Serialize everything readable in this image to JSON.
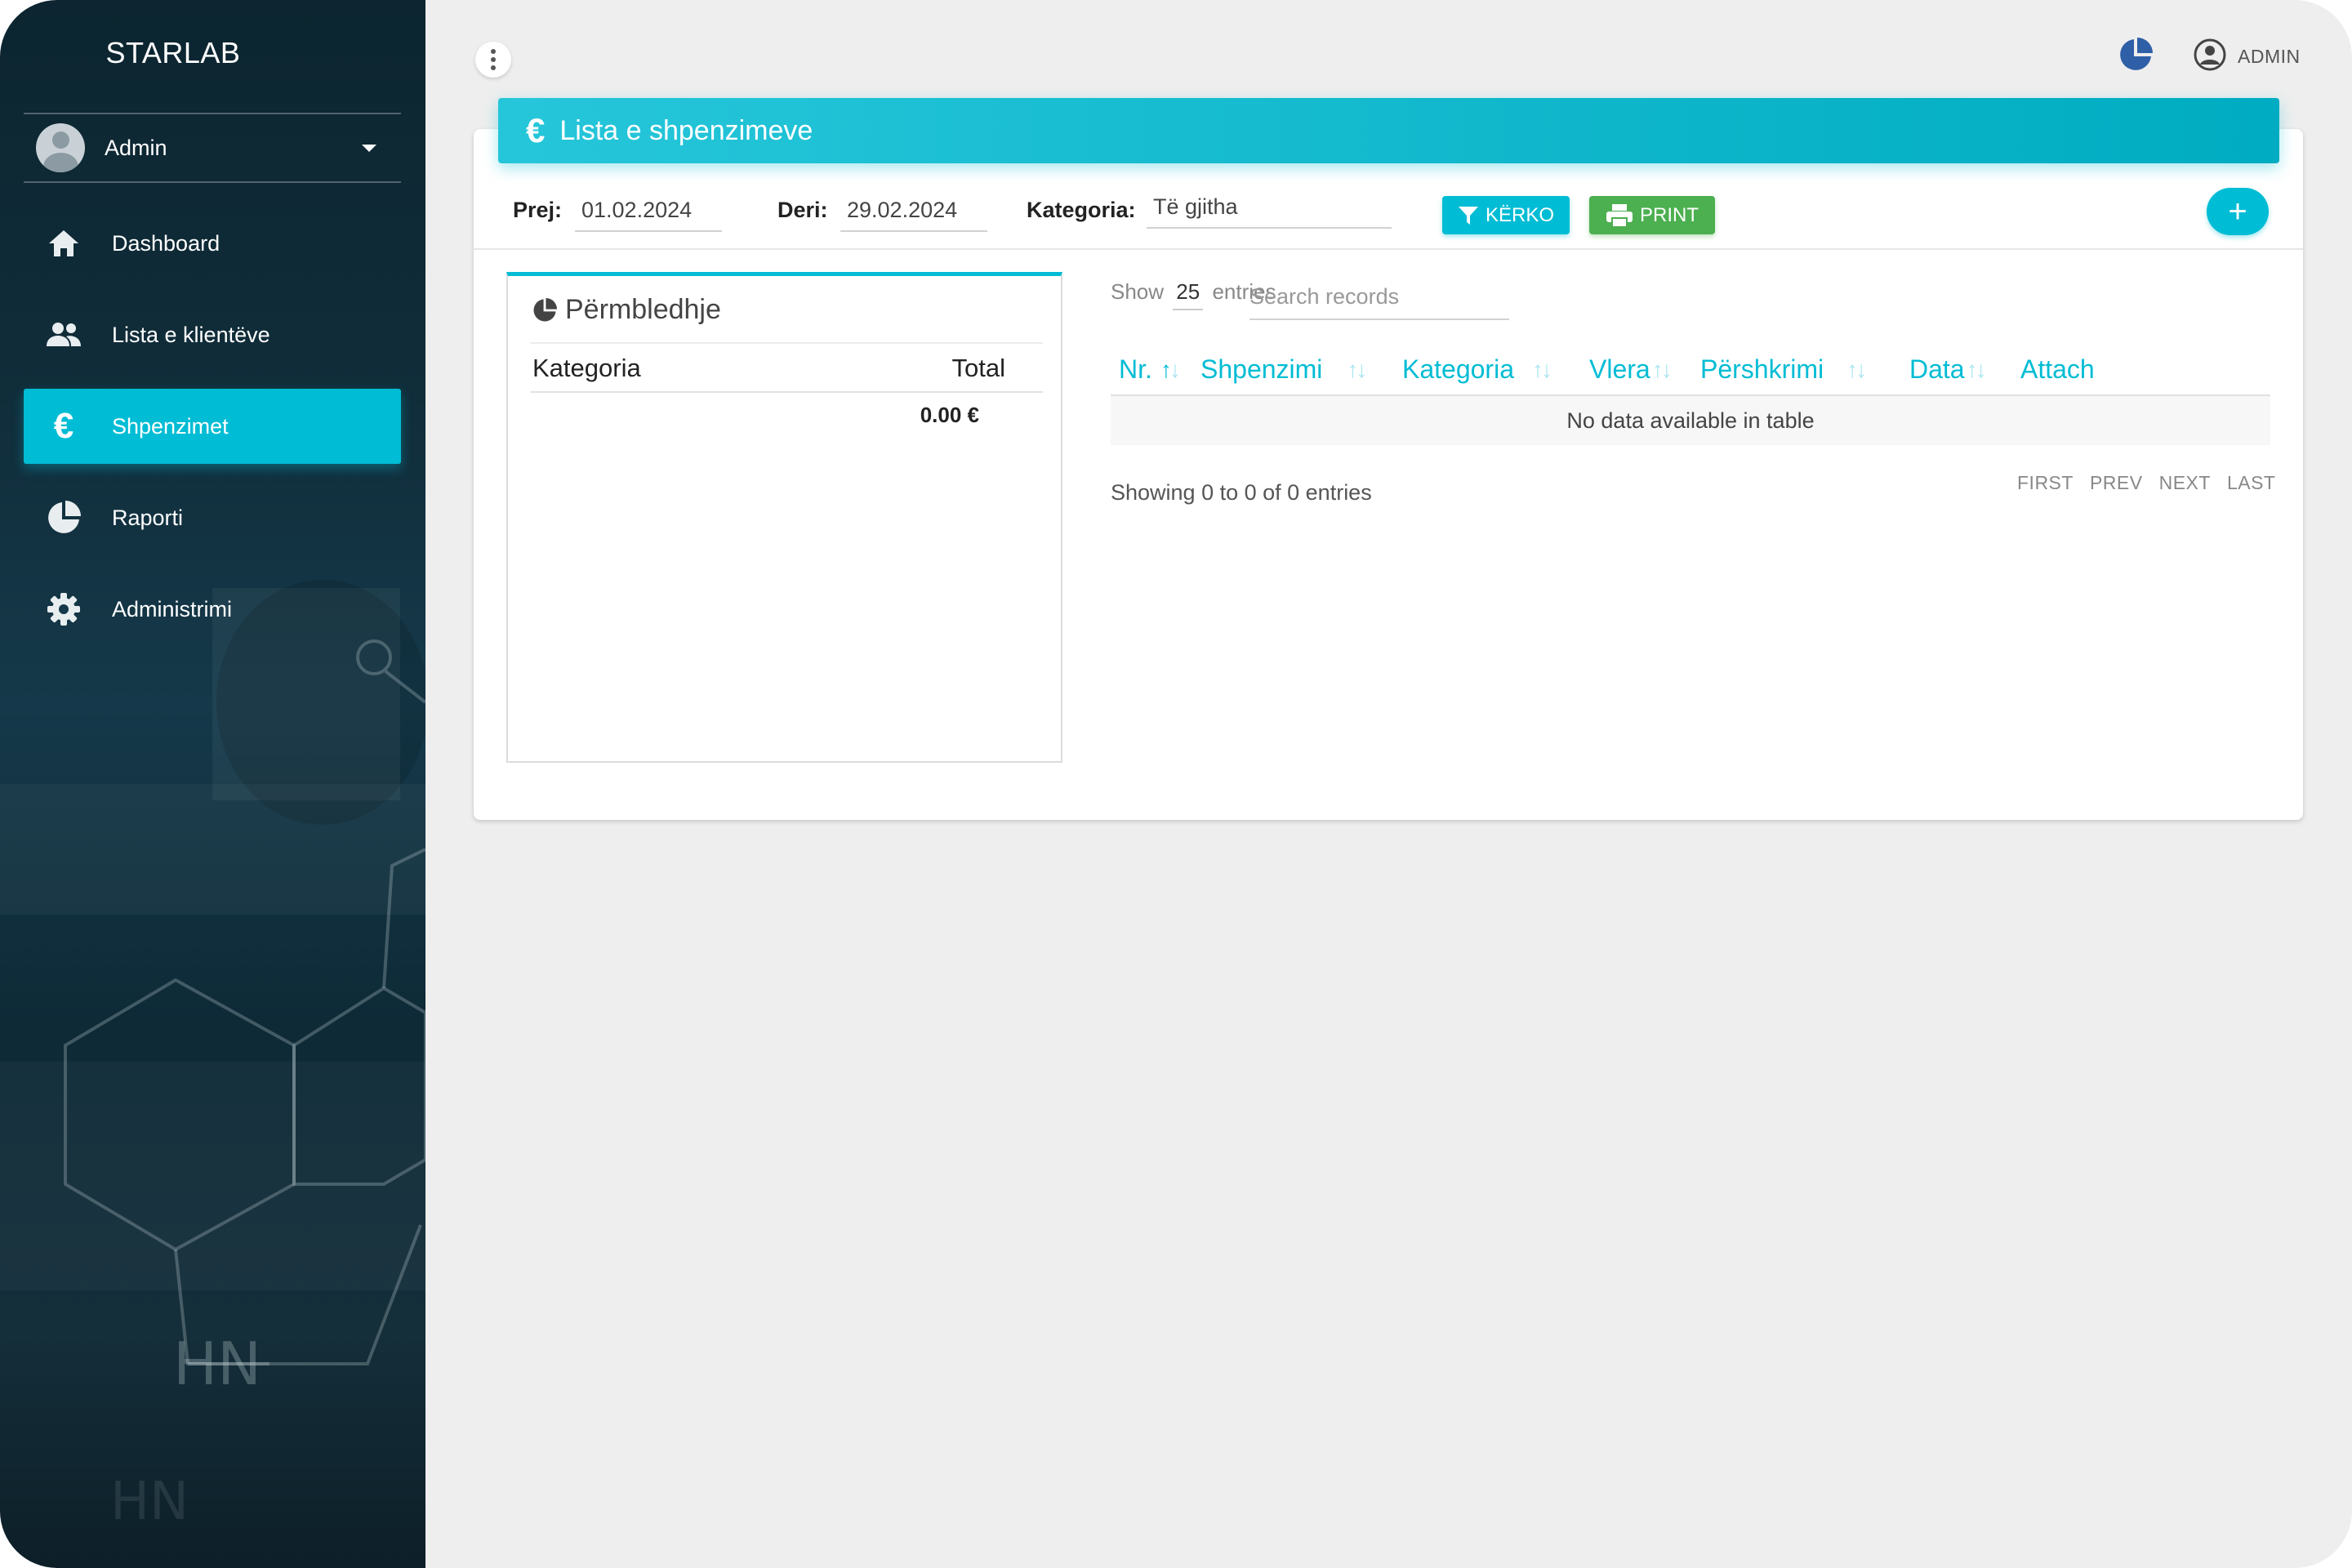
{
  "sidebar": {
    "brand": "STARLAB",
    "user": {
      "name": "Admin"
    },
    "items": [
      {
        "label": "Dashboard",
        "icon": "home-icon"
      },
      {
        "label": "Lista e klientëve",
        "icon": "users-icon"
      },
      {
        "label": "Shpenzimet",
        "icon": "euro-icon",
        "active": true
      },
      {
        "label": "Raporti",
        "icon": "pie-chart-icon"
      },
      {
        "label": "Administrimi",
        "icon": "gear-icon"
      }
    ],
    "background_text": "HN"
  },
  "topbar": {
    "user_label": "ADMIN"
  },
  "page": {
    "title": "Lista e shpenzimeve",
    "title_icon": "€"
  },
  "filters": {
    "from_label": "Prej:",
    "from_value": "01.02.2024",
    "to_label": "Deri:",
    "to_value": "29.02.2024",
    "category_label": "Kategoria:",
    "category_value": "Të gjitha",
    "search_button": "KËRKO",
    "print_button": "PRINT",
    "add_button": "+"
  },
  "summary": {
    "title": "Përmbledhje",
    "col_category": "Kategoria",
    "col_total": "Total",
    "total_value": "0.00 €"
  },
  "table": {
    "show_prefix": "Show",
    "page_size": "25",
    "show_suffix": "entries",
    "search_placeholder": "Search records",
    "columns": [
      "Nr.",
      "Shpenzimi",
      "Kategoria",
      "Vlera",
      "Përshkrimi",
      "Data",
      "Attach"
    ],
    "empty_text": "No data available in table",
    "info": "Showing 0 to 0 of 0 entries",
    "pager": {
      "first": "FIRST",
      "prev": "PREV",
      "next": "NEXT",
      "last": "LAST"
    }
  },
  "colors": {
    "accent": "#00bcd4",
    "print": "#4caf50",
    "sidebar_bg": "#102d3a"
  }
}
